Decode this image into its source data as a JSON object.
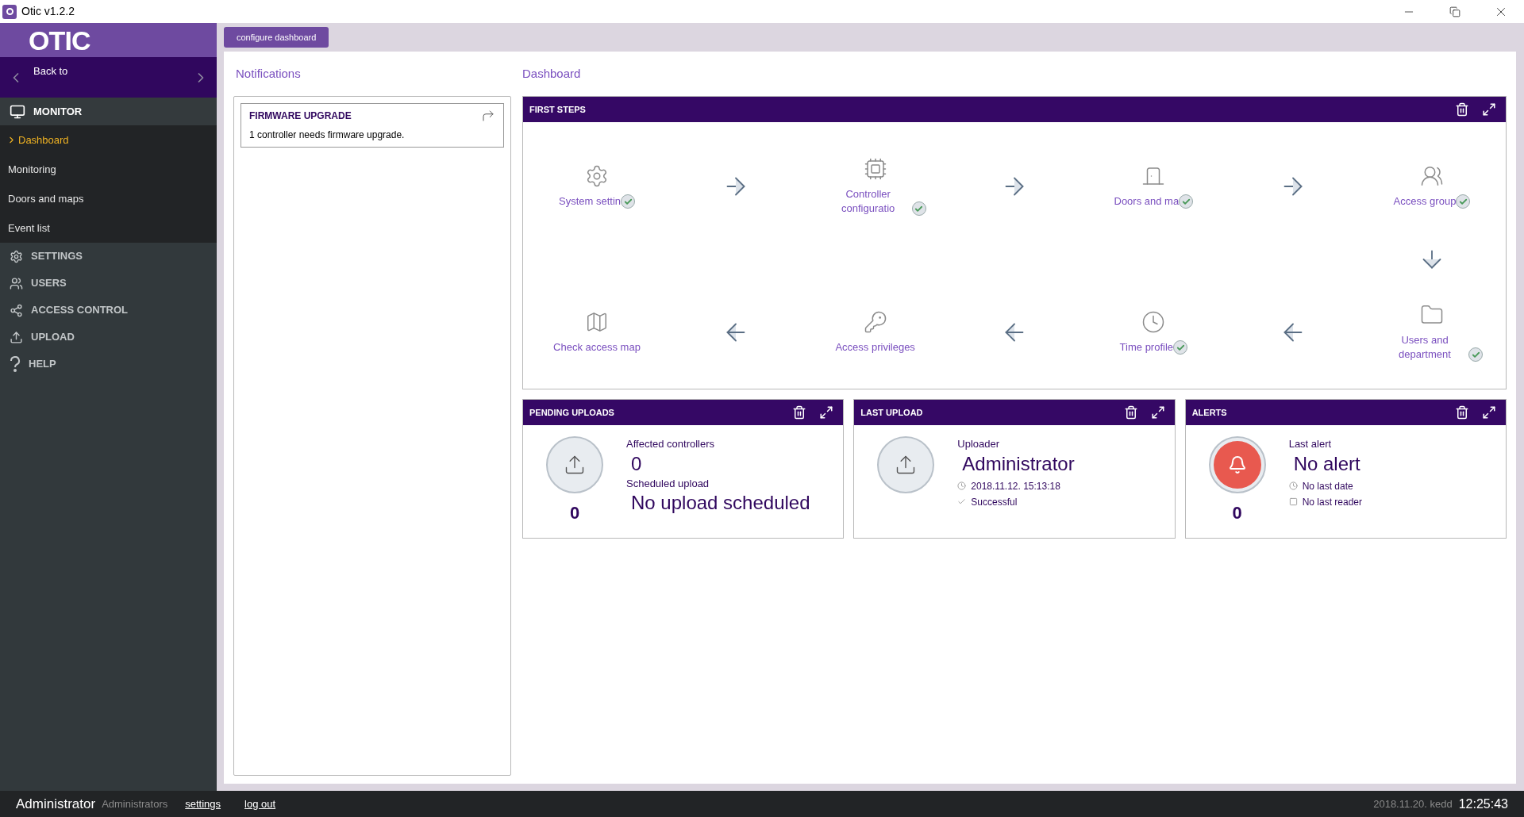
{
  "window": {
    "title": "Otic v1.2.2"
  },
  "sidebar": {
    "logo": "OTIC",
    "back": "Back to",
    "items": [
      {
        "kind": "section",
        "label": "MONITOR",
        "expanded": true
      },
      {
        "kind": "sub",
        "label": "Dashboard",
        "selected": true
      },
      {
        "kind": "sub",
        "label": "Monitoring",
        "selected": false
      },
      {
        "kind": "sub",
        "label": "Doors and maps",
        "selected": false
      },
      {
        "kind": "sub",
        "label": "Event list",
        "selected": false
      },
      {
        "kind": "section",
        "label": "SETTINGS",
        "expanded": false
      },
      {
        "kind": "section",
        "label": "USERS",
        "expanded": false
      },
      {
        "kind": "section",
        "label": "ACCESS CONTROL",
        "expanded": false
      },
      {
        "kind": "section",
        "label": "UPLOAD",
        "expanded": false
      },
      {
        "kind": "section",
        "label": "HELP",
        "expanded": false
      }
    ]
  },
  "toolbar": {
    "button": "configure dashboard"
  },
  "notifications": {
    "title": "Notifications",
    "items": [
      {
        "title": "FIRMWARE UPGRADE",
        "text": "1 controller needs firmware upgrade."
      }
    ]
  },
  "dashboard": {
    "title": "Dashboard",
    "first_steps": {
      "title": "FIRST STEPS",
      "steps": [
        {
          "label": "System settin",
          "done": true
        },
        {
          "label": "Controller configuratio",
          "done": true
        },
        {
          "label": "Doors and ma",
          "done": true
        },
        {
          "label": "Access group",
          "done": true
        },
        {
          "label": "Check access map",
          "done": false
        },
        {
          "label": "Access privileges",
          "done": false
        },
        {
          "label": "Time profile",
          "done": true
        },
        {
          "label": "Users and department",
          "done": true
        }
      ]
    },
    "widgets": [
      {
        "kind": "pending",
        "title": "PENDING UPLOADS",
        "count": "0",
        "fields": [
          {
            "label": "Affected controllers",
            "value": "0"
          },
          {
            "label": "Scheduled upload",
            "value": "No upload scheduled"
          }
        ]
      },
      {
        "kind": "last_upload",
        "title": "LAST UPLOAD",
        "fields": [
          {
            "label": "Uploader",
            "value": "Administrator"
          }
        ],
        "details": [
          "2018.11.12. 15:13:18",
          "Successful"
        ]
      },
      {
        "kind": "alerts",
        "title": "ALERTS",
        "count": "0",
        "fields": [
          {
            "label": "Last alert",
            "value": "No alert"
          }
        ],
        "details": [
          "No last date",
          "No last reader"
        ]
      }
    ]
  },
  "status_bar": {
    "user": "Administrator",
    "group": "Administrators",
    "links": [
      "settings",
      "log out"
    ],
    "date": "2018.11.20. kedd",
    "time": "12:25:43"
  }
}
